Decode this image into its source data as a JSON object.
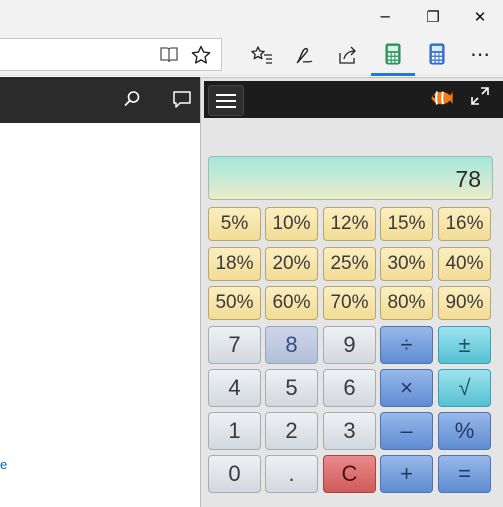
{
  "window": {
    "minimize_icon": "minimize-icon",
    "restore_icon": "restore-icon",
    "close_icon": "close-icon",
    "minimize_glyph": "─",
    "restore_glyph": "❐",
    "close_glyph": "✕"
  },
  "toolbar": {
    "icons": [
      "reading-view-icon",
      "favorite-star-icon",
      "favorites-hub-icon",
      "web-note-icon",
      "share-icon",
      "percentage-calculator-icon",
      "calculator-icon",
      "more-icon"
    ],
    "more_glyph": "⋯",
    "active_color": "#1f7bd6"
  },
  "page": {
    "link_text": "e",
    "header_icons": [
      "search-icon",
      "comment-icon"
    ]
  },
  "calculator": {
    "display_value": "78",
    "percent_buttons": [
      "5%",
      "10%",
      "12%",
      "15%",
      "16%",
      "18%",
      "20%",
      "25%",
      "30%",
      "40%",
      "50%",
      "60%",
      "70%",
      "80%",
      "90%"
    ],
    "keys": {
      "k7": "7",
      "k8": "8",
      "k9": "9",
      "divide": "÷",
      "plusminus": "±",
      "k4": "4",
      "k5": "5",
      "k6": "6",
      "multiply": "×",
      "sqrt": "√",
      "k1": "1",
      "k2": "2",
      "k3": "3",
      "minus": "–",
      "percent": "%",
      "k0": "0",
      "dot": ".",
      "clear": "C",
      "plus": "+",
      "equals": "="
    },
    "colors": {
      "display_gradient_top": "#a6e6da",
      "percent_button": "#f2dc96",
      "operator_button": "#5f8cd2",
      "clear_button": "#d05a5a",
      "cyan_button": "#55c0d3"
    }
  }
}
